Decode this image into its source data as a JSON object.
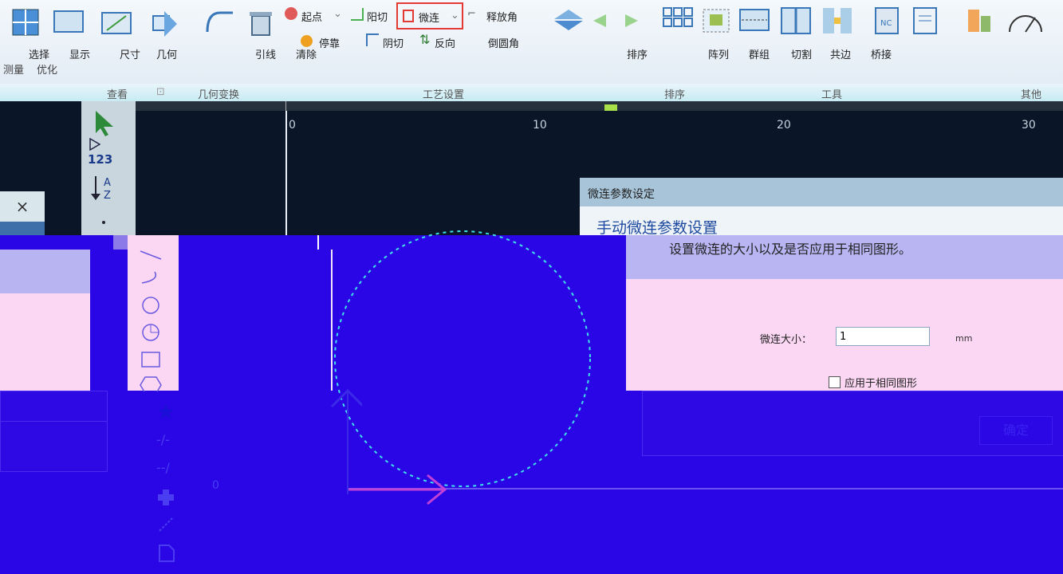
{
  "ribbon": {
    "qiDian": "起点",
    "yangQie": "阳切",
    "weiLian": "微连",
    "shiFangJiao": "释放角",
    "tingKao": "停靠",
    "yinQie": "阴切",
    "fanXiang": "反向",
    "daoYuanJiao": "倒圆角",
    "xuanZe": "选择",
    "xianShi": "显示",
    "chiCun": "尺寸",
    "jiHe": "几何",
    "yinXian": "引线",
    "qingChu": "清除",
    "paiXu": "排序",
    "zhenLie": "阵列",
    "shiZu": "群组",
    "qieGe": "切割",
    "gongBian": "共边",
    "qiaoJie": "桥接",
    "ceLiang": "测量",
    "youHua": "优化"
  },
  "groups": {
    "chaKan": "查看",
    "jiHeBianHuan": "几何变换",
    "gongYiSheZhi": "工艺设置",
    "paiXu": "排序",
    "gongJu": "工具",
    "qiTa": "其他"
  },
  "ruler": {
    "t0": "0",
    "t10": "10",
    "t20": "20",
    "t30": "30"
  },
  "canvas": {
    "origin": "0"
  },
  "left_bar": {
    "num123": "123"
  },
  "pane": {
    "close": "×"
  },
  "dialog": {
    "title": "微连参数设定",
    "heading": "手动微连参数设置",
    "desc": "设置微连的大小以及是否应用于相同图形。",
    "size_label": "微连大小：",
    "size_value": "1",
    "unit": "mm",
    "apply_label": "应用于相同图形",
    "ok": "确定"
  },
  "colors": {
    "accent_red": "#e53935",
    "band_blue": "#2a06e6",
    "canvas_bg": "#0a1628"
  }
}
